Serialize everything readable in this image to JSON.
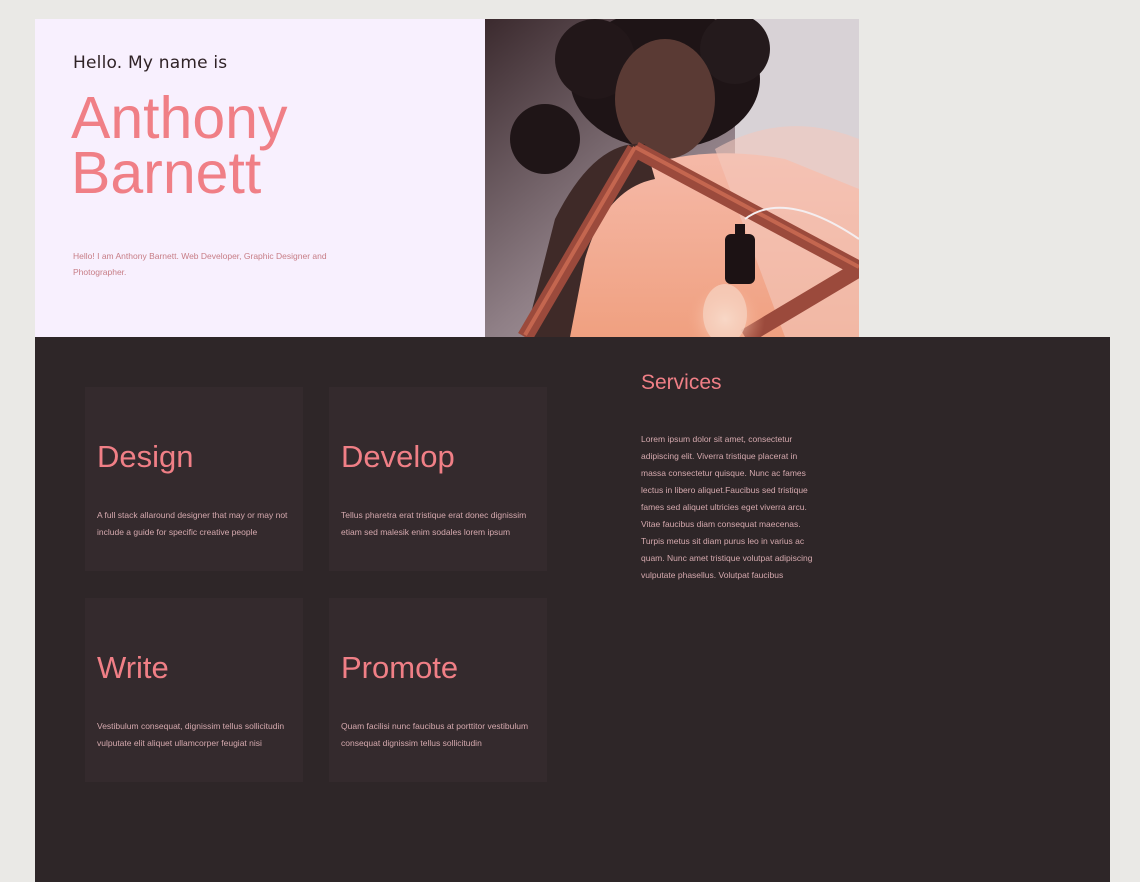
{
  "hero": {
    "greeting": "Hello. My name is",
    "first_name": "Anthony",
    "last_name": "Barnett",
    "intro": "Hello! I am Anthony Barnett. Web Developer, Graphic Designer and Photographer."
  },
  "cards": [
    {
      "title": "Design",
      "text": "A full stack allaround designer that may or may not include a guide for specific creative people"
    },
    {
      "title": "Develop",
      "text": "Tellus pharetra erat tristique erat donec dignissim etiam sed malesik enim sodales lorem ipsum"
    },
    {
      "title": "Write",
      "text": "Vestibulum consequat, dignissim tellus sollicitudin vulputate elit aliquet ullamcorper feugiat nisi"
    },
    {
      "title": "Promote",
      "text": "Quam facilisi nunc faucibus at porttitor vestibulum consequat dignissim tellus sollicitudin"
    }
  ],
  "services": {
    "title": "Services",
    "text": "Lorem ipsum dolor sit amet, consectetur adipiscing elit. Viverra tristique placerat in massa consectetur quisque. Nunc ac fames lectus in libero aliquet.Faucibus sed tristique fames sed aliquet ultricies eget viverra arcu. Vitae faucibus diam consequat maecenas. Turpis metus sit diam purus leo in varius ac quam. Nunc amet tristique volutpat adipiscing vulputate phasellus. Volutpat faucibus"
  },
  "colors": {
    "accent": "#f07f86",
    "hero_background": "#f8f0fe",
    "dark_background": "#2e2628",
    "card_background": "#342a2d",
    "page_background": "#eae9e6"
  }
}
